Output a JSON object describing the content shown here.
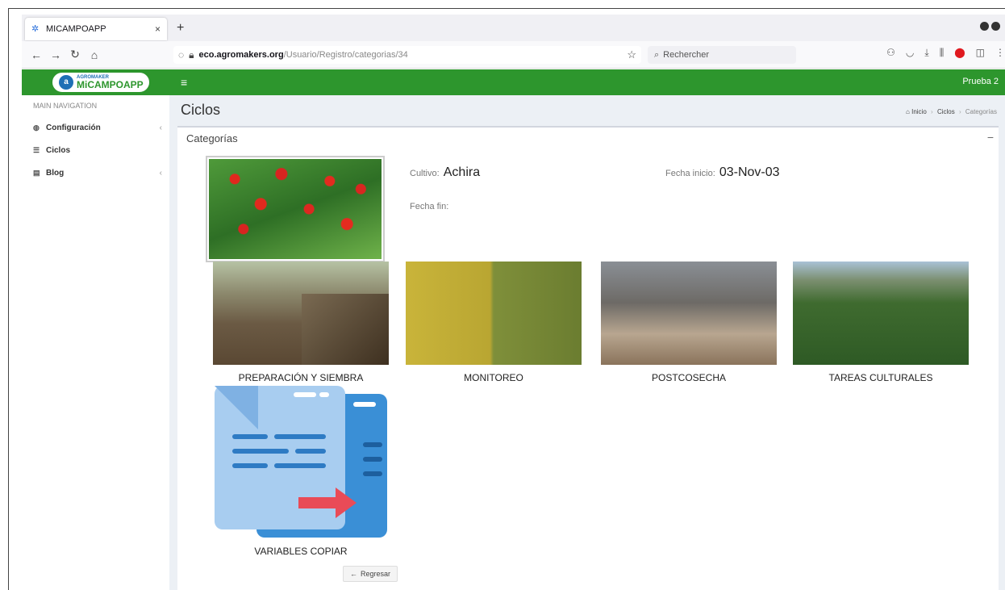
{
  "browser": {
    "tab_title": "MICAMPOAPP",
    "tab_close": "×",
    "new_tab": "+",
    "url_host": "eco.agromakers.org",
    "url_path": "/Usuario/Registro/categorias/34",
    "search_placeholder": "Rechercher"
  },
  "app": {
    "logo_small": "AGROMAKER",
    "logo_big": "MiCAMPOAPP",
    "user_label": "Prueba 2"
  },
  "sidebar": {
    "header": "MAIN NAVIGATION",
    "items": [
      {
        "label": "Configuración",
        "icon": "dashboard-icon",
        "has_chevron": true
      },
      {
        "label": "Ciclos",
        "icon": "list-icon",
        "has_chevron": false
      },
      {
        "label": "Blog",
        "icon": "newspaper-icon",
        "has_chevron": true
      }
    ]
  },
  "page": {
    "title": "Ciclos",
    "breadcrumb": [
      "Inicio",
      "Ciclos",
      "Categorías"
    ]
  },
  "box": {
    "title": "Categorías",
    "minimize": "−"
  },
  "crop": {
    "cultivo_label": "Cultivo:",
    "cultivo_value": "Achira",
    "fecha_inicio_label": "Fecha inicio:",
    "fecha_inicio_value": "03-Nov-03",
    "fecha_fin_label": "Fecha fin:",
    "fecha_fin_value": ""
  },
  "categories": [
    {
      "label": "PREPARACIÓN Y SIEMBRA"
    },
    {
      "label": "MONITOREO"
    },
    {
      "label": "POSTCOSECHA"
    },
    {
      "label": "TAREAS CULTURALES"
    },
    {
      "label": "VARIABLES COPIAR"
    }
  ],
  "actions": {
    "back_label": "Regresar"
  },
  "colors": {
    "header_green": "#2d962d",
    "content_bg": "#ecf0f5",
    "doc_blue": "#3a8fd6",
    "arrow_red": "#e94b57"
  }
}
